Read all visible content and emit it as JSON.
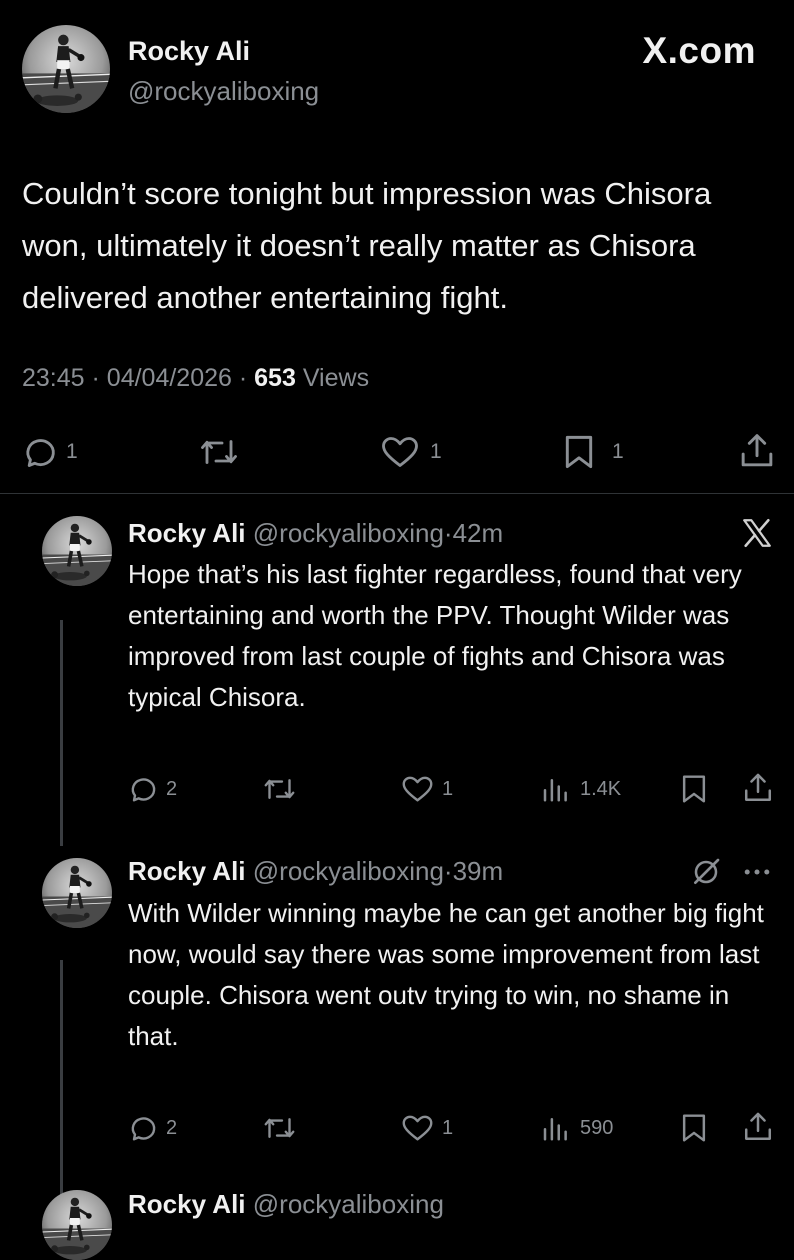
{
  "brand": {
    "site": "X.com"
  },
  "main_tweet": {
    "name": "Rocky Ali",
    "handle": "@rockyaliboxing",
    "text": "Couldn’t score tonight but impression was Chisora won, ultimately it doesn’t really matter as Chisora delivered another entertaining fight.",
    "time": "23:45",
    "date": "04/04/2026",
    "views_count": "653",
    "views_label": "Views",
    "separator": "·",
    "actions": {
      "replies": "1",
      "likes": "1",
      "bookmarks": "1"
    }
  },
  "replies": [
    {
      "name": "Rocky Ali",
      "handle": "@rockyaliboxing",
      "separator": "·",
      "age": "42m",
      "text": "Hope that’s his last fighter regardless, found that very entertaining and worth the PPV. Thought Wilder was improved from last couple of fights and Chisora was typical Chisora.",
      "actions": {
        "replies": "2",
        "likes": "1",
        "views": "1.4K"
      }
    },
    {
      "name": "Rocky Ali",
      "handle": "@rockyaliboxing",
      "separator": "·",
      "age": "39m",
      "text": "With Wilder winning maybe he can get another big fight now, would say there was some improvement from last couple. Chisora went outv trying to win, no shame in that.",
      "actions": {
        "replies": "2",
        "likes": "1",
        "views": "590"
      }
    },
    {
      "name": "Rocky Ali",
      "handle": "@rockyaliboxing"
    }
  ],
  "icons": {
    "reply": "reply-icon",
    "repost": "repost-icon",
    "like": "like-icon",
    "bookmark": "bookmark-icon",
    "share": "share-icon",
    "views": "views-icon",
    "x_logo": "x-logo-icon",
    "grok": "grok-icon",
    "more": "more-icon"
  },
  "colors": {
    "background": "#000000",
    "text": "#e7e9ea",
    "muted": "#8b8f94",
    "divider": "#2f3336"
  }
}
